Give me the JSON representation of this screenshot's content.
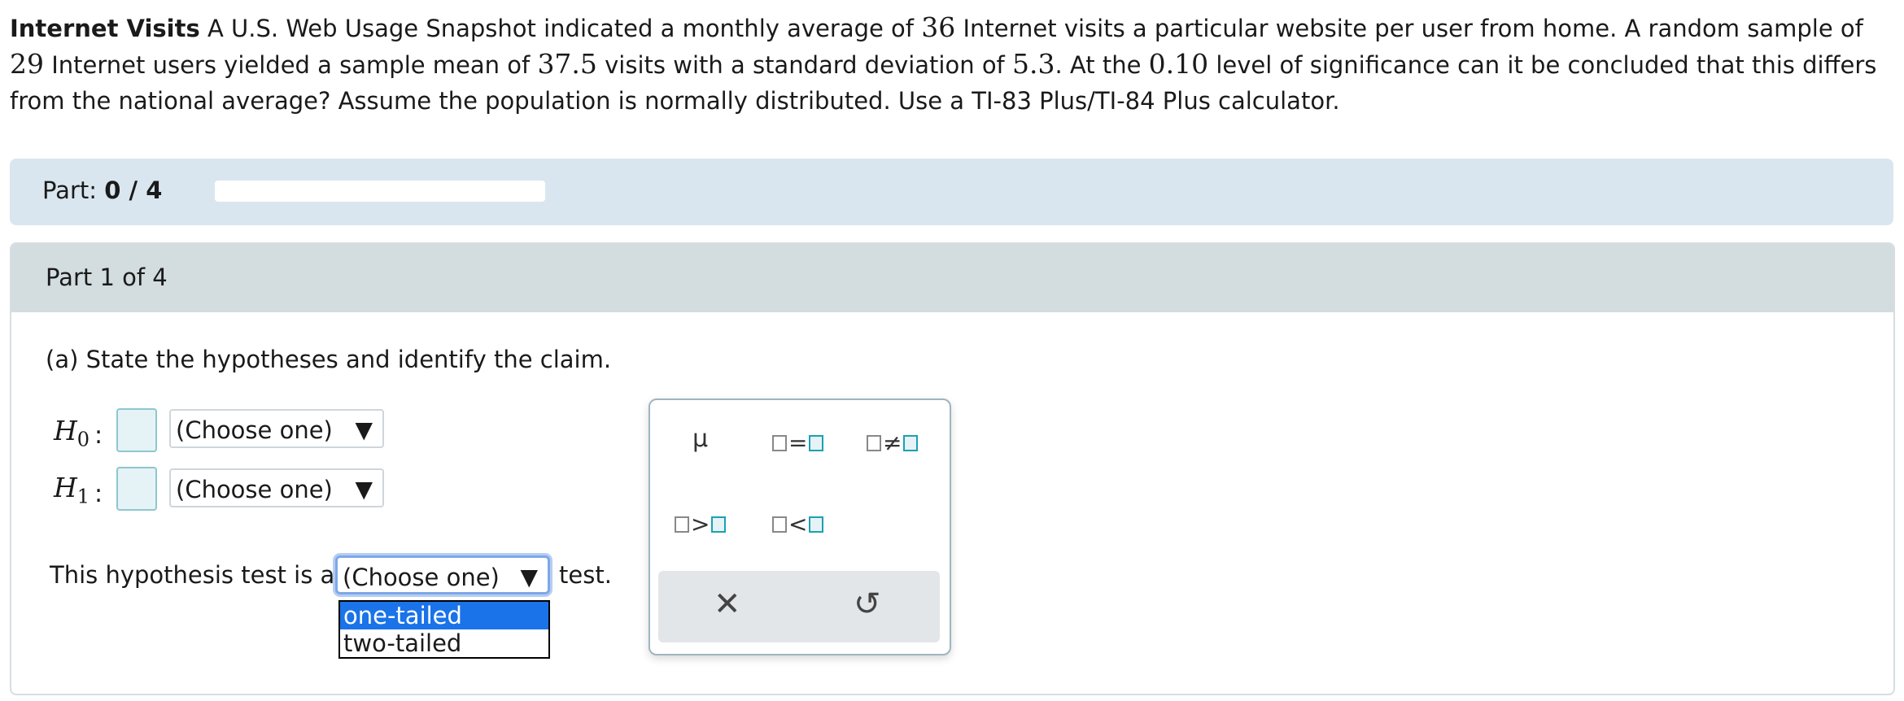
{
  "problem": {
    "title": "Internet Visits",
    "text_1": " A U.S. Web Usage Snapshot indicated a monthly average of ",
    "v1": "36",
    "text_2": " Internet visits a particular website per user from home. A random sample of ",
    "v2": "29",
    "text_3": " Internet users yielded a sample mean of ",
    "v3": "37.5",
    "text_4": " visits with a standard deviation of ",
    "v4": "5.3",
    "text_5": ". At the ",
    "v5": "0.10",
    "text_6": " level of significance can it be concluded that this differs from the national average? Assume the population is normally distributed. Use a TI-83 Plus/TI-84 Plus calculator."
  },
  "progress": {
    "label": "Part: ",
    "value": "0 / 4",
    "fraction": 0
  },
  "part": {
    "header": "Part 1 of 4",
    "question": "(a)  State the hypotheses and identify the claim.",
    "h0_symbol": "H",
    "h0_sub": "0",
    "h1_symbol": "H",
    "h1_sub": "1",
    "colon": ":",
    "h0_select": "(Choose one)",
    "h1_select": "(Choose one)",
    "sentence_prefix": "This hypothesis test is a",
    "sentence_suffix": "test.",
    "test_select": "(Choose one)",
    "arrow": "▼",
    "dropdown_options": [
      "one-tailed",
      "two-tailed"
    ]
  },
  "palette": {
    "mu": "μ",
    "eq": "=",
    "neq": "≠",
    "gt": ">",
    "lt": "<",
    "clear": "✕",
    "undo": "↺"
  }
}
